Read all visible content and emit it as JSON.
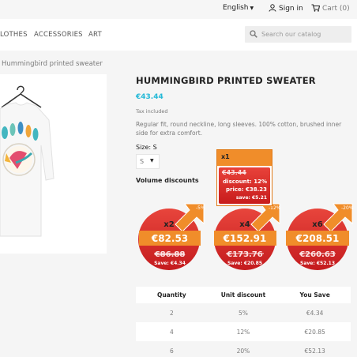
{
  "topbar": {
    "language": "English",
    "signin": "Sign in",
    "cart": "Cart (0)"
  },
  "nav": {
    "items": [
      "LOTHES",
      "ACCESSORIES",
      "ART"
    ],
    "search_placeholder": "Search our catalog"
  },
  "breadcrumb": "Hummingbird printed sweater",
  "product": {
    "title": "HUMMINGBIRD PRINTED SWEATER",
    "price": "€43.44",
    "tax": "Tax included",
    "description": "Regular fit, round neckline, long sleeves. 100% cotton, brushed inner side for extra comfort.",
    "size_label": "Size: S",
    "size_value": "S",
    "volume_title": "Volume discounts"
  },
  "badges": [
    {
      "qty": "x2",
      "price": "€82.53",
      "old": "€86.88",
      "save": "Save: €4.34",
      "percent": "-5%"
    },
    {
      "qty": "x4",
      "price": "€152.91",
      "old": "€173.76",
      "save": "Save: €20.85",
      "percent": "-12%"
    },
    {
      "qty": "x6",
      "price": "€208.51",
      "old": "€260.63",
      "save": "Save: €52.13",
      "percent": "-20%"
    }
  ],
  "tooltip": {
    "qty": "x1",
    "old": "€43.44",
    "discount": "discount: 12%",
    "price": "price: €38.23",
    "save": "save: €5.21"
  },
  "table": {
    "headers": [
      "Quantity",
      "Unit discount",
      "You Save"
    ],
    "rows": [
      [
        "2",
        "5%",
        "€4.34"
      ],
      [
        "4",
        "12%",
        "€20.85"
      ],
      [
        "6",
        "20%",
        "€52.13"
      ]
    ]
  },
  "colors": {
    "accent": "#24b9d7",
    "badge_orange": "#f08d2a",
    "badge_red": "#d9262a"
  }
}
